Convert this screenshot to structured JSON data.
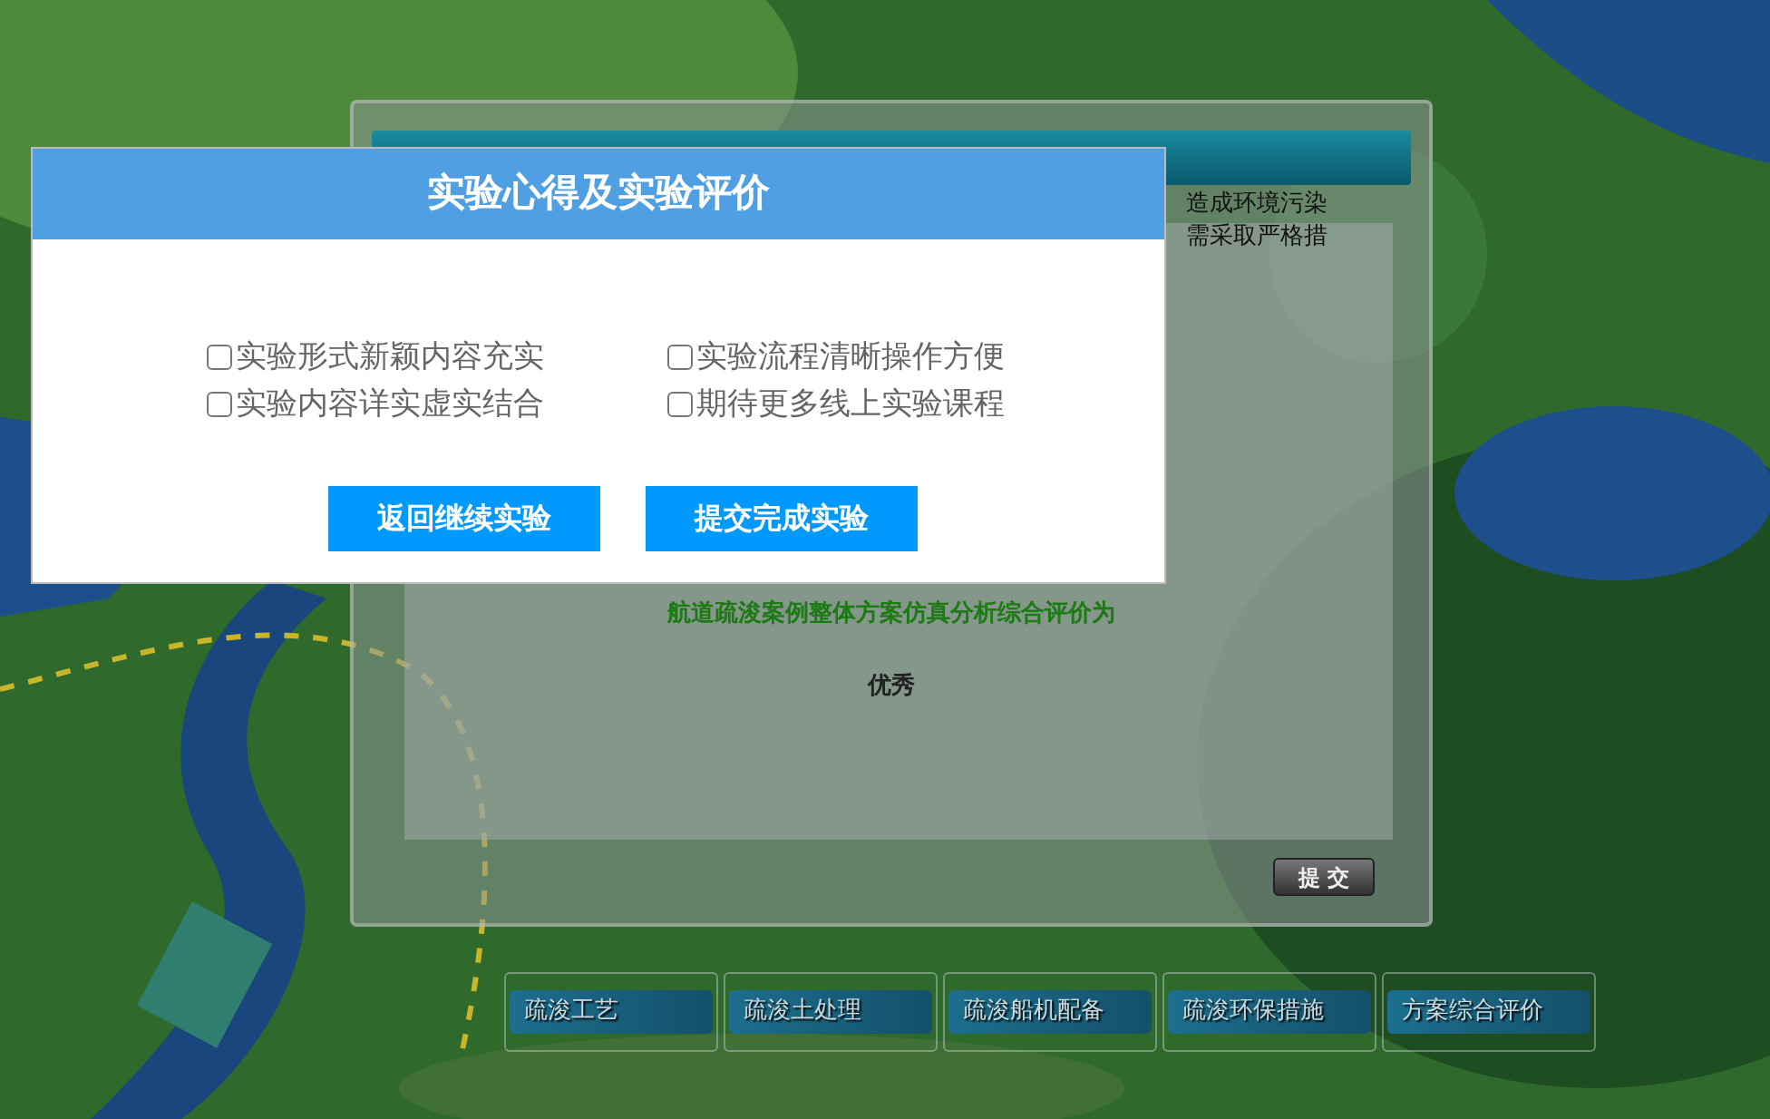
{
  "result_panel": {
    "notes": [
      "造成环境污染",
      "需采取严格措"
    ],
    "summary": "航道疏浚案例整体方案仿真分析综合评价为",
    "grade": "优秀",
    "submit_button": "提 交"
  },
  "nav_tabs": [
    {
      "label": "疏浚工艺"
    },
    {
      "label": "疏浚土处理"
    },
    {
      "label": "疏浚船机配备"
    },
    {
      "label": "疏浚环保措施"
    },
    {
      "label": "方案综合评价"
    }
  ],
  "dialog": {
    "title": "实验心得及实验评价",
    "options": [
      {
        "label": "实验形式新颖内容充实",
        "checked": false
      },
      {
        "label": "实验流程清晰操作方便",
        "checked": false
      },
      {
        "label": "实验内容详实虚实结合",
        "checked": false
      },
      {
        "label": "期待更多线上实验课程",
        "checked": false
      }
    ],
    "buttons": [
      "返回继续实验",
      "提交完成实验"
    ]
  }
}
